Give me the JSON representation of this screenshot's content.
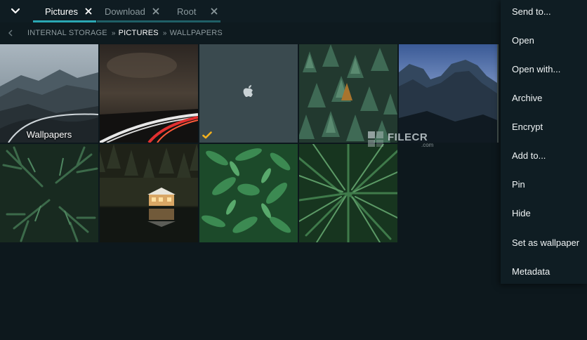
{
  "tabs": [
    {
      "label": "Pictures",
      "active": true
    },
    {
      "label": "Download",
      "active": false
    },
    {
      "label": "Root",
      "active": false
    }
  ],
  "breadcrumb": {
    "items": [
      "INTERNAL STORAGE",
      "PICTURES",
      "WALLPAPERS"
    ],
    "separator": "»"
  },
  "grid": {
    "folder_label": "Wallpapers",
    "selected_tile": "apple-wallpaper"
  },
  "watermark": {
    "text": "FILECR",
    "sub": ".com"
  },
  "menu": {
    "items": [
      "Send to...",
      "Open",
      "Open with...",
      "Archive",
      "Encrypt",
      "Add to...",
      "Pin",
      "Hide",
      "Set as wallpaper",
      "Metadata"
    ]
  },
  "colors": {
    "accent": "#2aa7b3",
    "background": "#0d181d",
    "checkmark": "#f2b01e"
  }
}
